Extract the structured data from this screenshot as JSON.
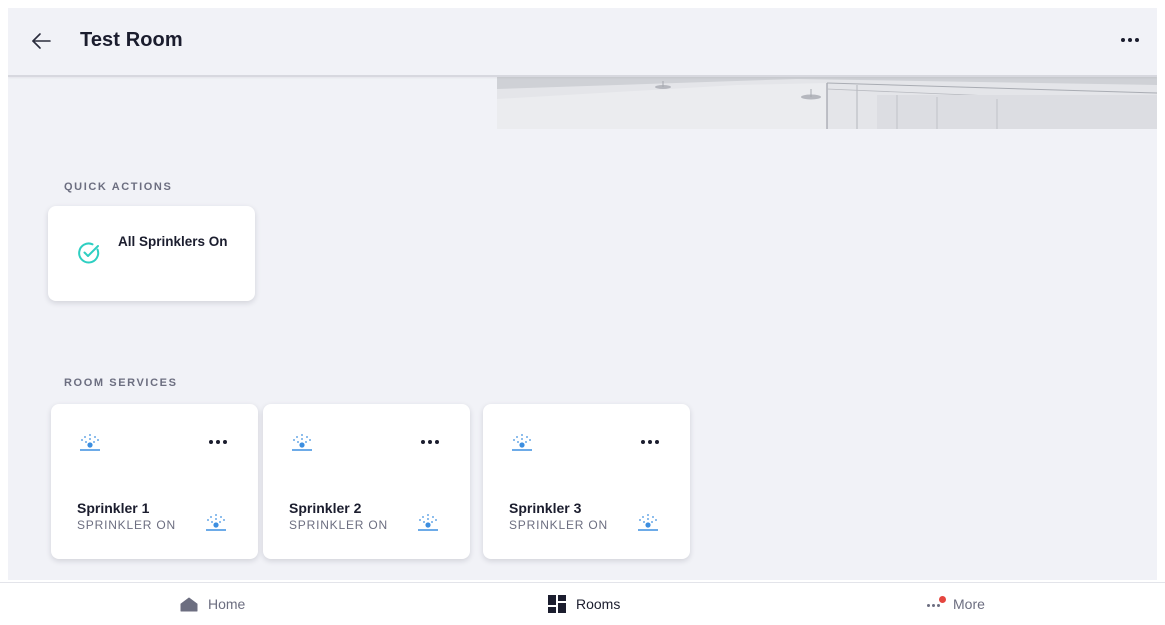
{
  "header": {
    "title": "Test Room",
    "back_icon": "arrow-left-icon",
    "more_icon": "more-horizontal-icon"
  },
  "quick_actions": {
    "label": "QUICK ACTIONS",
    "items": [
      {
        "label": "All Sprinklers On",
        "icon": "check-circle-icon"
      }
    ]
  },
  "room_services": {
    "label": "ROOM SERVICES",
    "items": [
      {
        "name": "Sprinkler 1",
        "status": "SPRINKLER ON",
        "icon": "sprinkler-icon"
      },
      {
        "name": "Sprinkler 2",
        "status": "SPRINKLER ON",
        "icon": "sprinkler-icon"
      },
      {
        "name": "Sprinkler 3",
        "status": "SPRINKLER ON",
        "icon": "sprinkler-icon"
      }
    ]
  },
  "bottom_nav": {
    "items": [
      {
        "label": "Home",
        "icon": "home-icon",
        "active": false
      },
      {
        "label": "Rooms",
        "icon": "rooms-grid-icon",
        "active": true
      },
      {
        "label": "More",
        "icon": "more-horizontal-icon",
        "active": false,
        "has_notification": true
      }
    ]
  },
  "colors": {
    "accent_check": "#2ecfc2",
    "sprinkler_blue": "#3d8fe0",
    "background": "#f1f2f7",
    "text_primary": "#1b1d2e",
    "text_secondary": "#6c6e80",
    "notification": "#e5463f"
  }
}
